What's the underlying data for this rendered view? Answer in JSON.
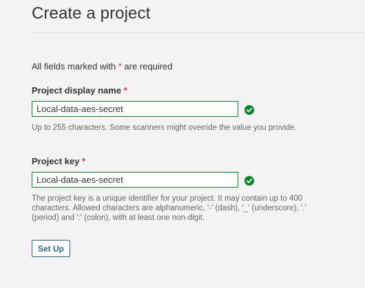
{
  "page": {
    "title": "Create a project"
  },
  "form": {
    "required_note_prefix": "All fields marked with",
    "required_star": "*",
    "required_note_suffix": "are required",
    "display_name": {
      "label": "Project display name",
      "required_star": "*",
      "value": "Local-data-aes-secret",
      "help": "Up to 255 characters. Some scanners might override the value you provide.",
      "valid_icon": "check-circle-icon"
    },
    "project_key": {
      "label": "Project key",
      "required_star": "*",
      "value": "Local-data-aes-secret",
      "help": "The project key is a unique identifier for your project. It may contain up to 400 characters. Allowed characters are alphanumeric, '-' (dash), '_' (underscore), '.' (period) and ':' (colon), with at least one non-digit.",
      "valid_icon": "check-circle-icon"
    },
    "submit_label": "Set Up"
  },
  "colors": {
    "background": "#f3f3f4",
    "valid_green": "#008a25",
    "required_red": "#d4333f",
    "button_blue": "#236a97"
  }
}
